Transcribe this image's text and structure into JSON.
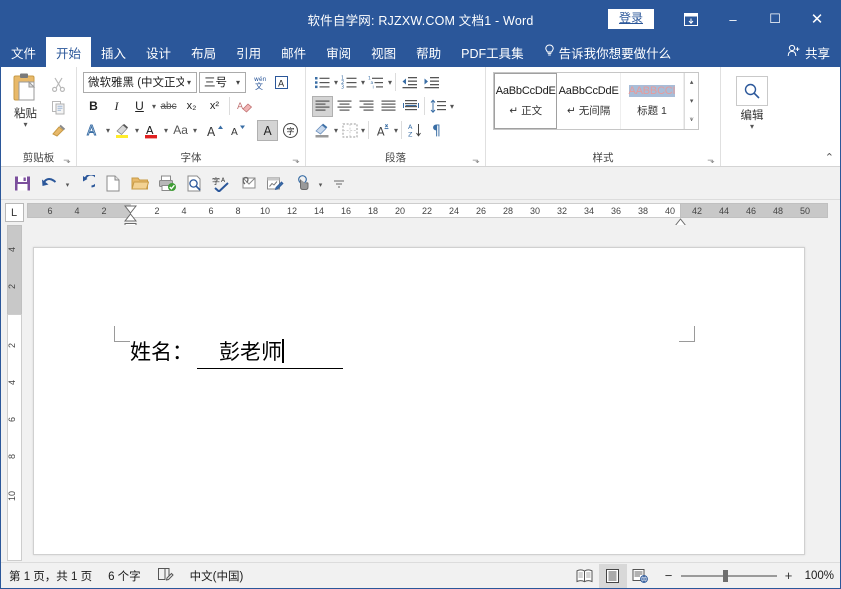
{
  "window": {
    "title": "软件自学网: RJZXW.COM 文档1  -  Word",
    "signin_label": "登录",
    "ribbon_display_icon": "ribbon-display-options-icon",
    "minimize_icon": "–",
    "maximize_icon": "☐",
    "close_icon": "✕",
    "accent_color": "#2b579a"
  },
  "tabs": [
    {
      "label": "文件",
      "name": "tab-file"
    },
    {
      "label": "开始",
      "name": "tab-home"
    },
    {
      "label": "插入",
      "name": "tab-insert"
    },
    {
      "label": "设计",
      "name": "tab-design"
    },
    {
      "label": "布局",
      "name": "tab-layout"
    },
    {
      "label": "引用",
      "name": "tab-references"
    },
    {
      "label": "邮件",
      "name": "tab-mailings"
    },
    {
      "label": "审阅",
      "name": "tab-review"
    },
    {
      "label": "视图",
      "name": "tab-view"
    },
    {
      "label": "帮助",
      "name": "tab-help"
    },
    {
      "label": "PDF工具集",
      "name": "tab-pdf-tools"
    }
  ],
  "tell_me": {
    "label": "告诉我你想要做什么",
    "icon": "lightbulb-icon"
  },
  "share": {
    "label": "共享",
    "icon": "share-person-icon"
  },
  "ribbon": {
    "clipboard": {
      "group_label": "剪贴板",
      "paste_label": "粘贴",
      "paste_caret": "▾",
      "cut_icon": "scissors-icon",
      "copy_icon": "copy-icon",
      "format_painter_icon": "format-painter-icon",
      "launcher": "⬎"
    },
    "font": {
      "group_label": "字体",
      "font_name": "微软雅黑 (中文正文)",
      "font_size": "三号",
      "caret": "▾",
      "phonetic_guide_icon": "phonetic-guide-icon",
      "character_border_icon": "character-border-icon",
      "bold": "B",
      "italic": "I",
      "underline": "U",
      "strikethrough": "abc",
      "subscript": "x₂",
      "superscript": "x²",
      "clear_format_icon": "clear-formatting-icon",
      "text_effects_icon": "text-effects-icon",
      "highlight_icon": "highlight-color-icon",
      "font_color_icon": "font-color-icon",
      "change_case": "Aa",
      "grow_font": "A",
      "shrink_font": "A",
      "text_shading_icon": "character-shading-icon",
      "enclose_char_icon": "enclose-character-icon",
      "launcher": "⬎"
    },
    "paragraph": {
      "group_label": "段落",
      "bullets_icon": "bullet-list-icon",
      "numbering_icon": "numbered-list-icon",
      "multilevel_icon": "multilevel-list-icon",
      "decrease_indent_icon": "decrease-indent-icon",
      "increase_indent_icon": "increase-indent-icon",
      "align_left_icon": "align-left-icon",
      "align_center_icon": "align-center-icon",
      "align_right_icon": "align-right-icon",
      "justify_icon": "justify-icon",
      "distribute_icon": "distribute-text-icon",
      "line_spacing_icon": "line-spacing-icon",
      "shading_icon": "shading-icon",
      "borders_icon": "borders-icon",
      "asian_layout_icon": "asian-layout-icon",
      "sort_icon": "sort-icon",
      "show_marks_icon": "show-formatting-marks-icon",
      "caret": "▾",
      "launcher": "⬎"
    },
    "styles": {
      "group_label": "样式",
      "items": [
        {
          "sample": "AaBbCcDdE",
          "name": "↵ 正文",
          "selected": true
        },
        {
          "sample": "AaBbCcDdE",
          "name": "↵ 无间隔",
          "selected": false
        },
        {
          "sample": "AABBCCI",
          "name": "标题 1",
          "selected": false
        }
      ],
      "scroll_up": "▴",
      "scroll_down": "▾",
      "scroll_more": "⩛",
      "launcher": "⬎"
    },
    "editing": {
      "group_label": "编辑",
      "icon": "search-icon",
      "caret": "▾"
    },
    "collapse_icon": "⌃"
  },
  "quick_toolbar": [
    {
      "name": "save-button",
      "icon": "save-icon"
    },
    {
      "name": "undo-button",
      "icon": "undo-icon"
    },
    {
      "name": "undo-caret",
      "icon": "▾"
    },
    {
      "name": "redo-button",
      "icon": "redo-icon"
    },
    {
      "name": "new-document-button",
      "icon": "new-document-icon"
    },
    {
      "name": "open-button",
      "icon": "open-folder-icon"
    },
    {
      "name": "quick-print-button",
      "icon": "quick-print-icon"
    },
    {
      "name": "print-preview-button",
      "icon": "print-preview-icon"
    },
    {
      "name": "spelling-grammar-button",
      "icon": "spelling-check-icon"
    },
    {
      "name": "email-attach-button",
      "icon": "email-attachment-icon"
    },
    {
      "name": "edit-chart-button",
      "icon": "edit-document-icon"
    },
    {
      "name": "touch-mode-button",
      "icon": "touch-mode-icon"
    },
    {
      "name": "touch-mode-caret",
      "icon": "▾"
    },
    {
      "name": "customize-toolbar-button",
      "icon": "⩬"
    }
  ],
  "ruler": {
    "tab_stop_icon": "L",
    "left_gray_ticks": [
      "6",
      "4",
      "2"
    ],
    "main_ticks": [
      "2",
      "4",
      "6",
      "8",
      "10",
      "12",
      "14",
      "16",
      "18",
      "20",
      "22",
      "24",
      "26",
      "28",
      "30",
      "32",
      "34",
      "36",
      "38",
      "40"
    ],
    "right_gray_ticks": [
      "42",
      "44",
      "46",
      "48",
      "50"
    ],
    "vertical_gray_ticks": [
      "4",
      "2"
    ],
    "vertical_main_ticks": [
      "2",
      "4",
      "6",
      "8",
      "10"
    ]
  },
  "document": {
    "label_text": "姓名：",
    "field_text": "彭老师",
    "caret": "|"
  },
  "status_bar": {
    "page_info": "第 1 页，共 1 页",
    "word_count": "6 个字",
    "proofing_icon": "proofing-errors-icon",
    "language": "中文(中国)",
    "read_mode_icon": "read-mode-icon",
    "print_layout_icon": "print-layout-icon",
    "web_layout_icon": "web-layout-icon",
    "zoom_out": "−",
    "zoom_in": "+",
    "zoom_level": "100%"
  }
}
